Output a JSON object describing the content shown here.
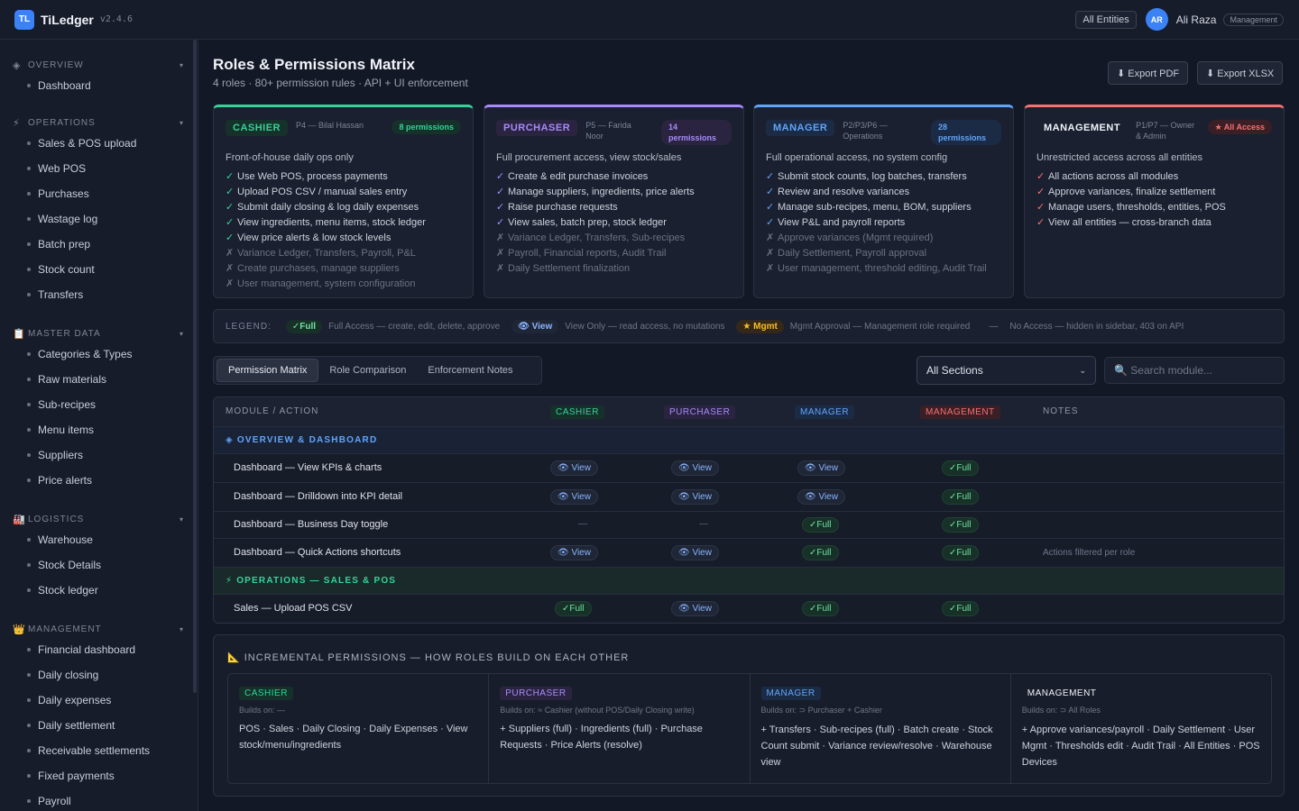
{
  "app": {
    "logo": "TL",
    "name": "TiLedger",
    "version": "v2.4.6"
  },
  "topbar": {
    "entity_button": "All Entities",
    "avatar": "AR",
    "user_name": "Ali Raza",
    "role": "Management"
  },
  "sidebar": {
    "sections": [
      {
        "icon": "◈",
        "icon_name": "overview-icon",
        "title": "OVERVIEW",
        "items": [
          "Dashboard"
        ]
      },
      {
        "icon": "⚡",
        "icon_name": "lightning-icon",
        "title": "OPERATIONS",
        "items": [
          "Sales & POS upload",
          "Web POS",
          "Purchases",
          "Wastage log",
          "Batch prep",
          "Stock count",
          "Transfers"
        ]
      },
      {
        "icon": "📋",
        "icon_name": "clipboard-icon",
        "title": "MASTER DATA",
        "items": [
          "Categories & Types",
          "Raw materials",
          "Sub-recipes",
          "Menu items",
          "Suppliers",
          "Price alerts"
        ]
      },
      {
        "icon": "🏭",
        "icon_name": "factory-icon",
        "title": "LOGISTICS",
        "items": [
          "Warehouse",
          "Stock Details",
          "Stock ledger"
        ]
      },
      {
        "icon": "👑",
        "icon_name": "crown-icon",
        "title": "MANAGEMENT",
        "items": [
          "Financial dashboard",
          "Daily closing",
          "Daily expenses",
          "Daily settlement",
          "Receivable settlements",
          "Fixed payments",
          "Payroll"
        ]
      }
    ]
  },
  "page": {
    "title": "Roles & Permissions Matrix",
    "subtitle": "4 roles · 80+ permission rules · API + UI enforcement",
    "export_pdf": "⬇ Export PDF",
    "export_xlsx": "⬇ Export XLSX"
  },
  "roles": [
    {
      "name": "CASHIER",
      "who": "P4 — Bilal Hassan",
      "count": "8 permissions",
      "color": "#34d399",
      "desc": "Front-of-house daily ops only",
      "allowed": [
        "Use Web POS, process payments",
        "Upload POS CSV / manual sales entry",
        "Submit daily closing & log daily expenses",
        "View ingredients, menu items, stock ledger",
        "View price alerts & low stock levels"
      ],
      "denied": [
        "Variance Ledger, Transfers, Payroll, P&L",
        "Create purchases, manage suppliers",
        "User management, system configuration"
      ]
    },
    {
      "name": "PURCHASER",
      "who": "P5 — Farida Noor",
      "count": "14 permissions",
      "color": "#a78bfa",
      "desc": "Full procurement access, view stock/sales",
      "allowed": [
        "Create & edit purchase invoices",
        "Manage suppliers, ingredients, price alerts",
        "Raise purchase requests",
        "View sales, batch prep, stock ledger"
      ],
      "denied": [
        "Variance Ledger, Transfers, Sub-recipes",
        "Payroll, Financial reports, Audit Trail",
        "Daily Settlement finalization"
      ]
    },
    {
      "name": "MANAGER",
      "who": "P2/P3/P6 — Operations",
      "count": "28 permissions",
      "color": "#60a5fa",
      "desc": "Full operational access, no system config",
      "allowed": [
        "Submit stock counts, log batches, transfers",
        "Review and resolve variances",
        "Manage sub-recipes, menu, BOM, suppliers",
        "View P&L and payroll reports"
      ],
      "denied": [
        "Approve variances (Mgmt required)",
        "Daily Settlement, Payroll approval",
        "User management, threshold editing, Audit Trail"
      ]
    },
    {
      "name": "MANAGEMENT",
      "who": "P1/P7 — Owner & Admin",
      "count": "★ All Access",
      "color": "#f87171",
      "desc": "Unrestricted access across all entities",
      "allowed": [
        "All actions across all modules",
        "Approve variances, finalize settlement",
        "Manage users, thresholds, entities, POS",
        "View all entities — cross-branch data"
      ],
      "denied": []
    }
  ],
  "legend": {
    "title": "LEGEND:",
    "full_pill": "✓Full",
    "full_text": "Full Access — create, edit, delete, approve",
    "view_pill": "👁 View",
    "view_text": "View Only — read access, no mutations",
    "mgmt_pill": "★ Mgmt",
    "mgmt_text": "Mgmt Approval — Management role required",
    "none_mark": "—",
    "none_text": "No Access — hidden in sidebar, 403 on API"
  },
  "tabs": [
    "Permission Matrix",
    "Role Comparison",
    "Enforcement Notes"
  ],
  "filter": {
    "selected": "All Sections",
    "search_placeholder": "🔍 Search module..."
  },
  "matrix": {
    "headers": {
      "module": "MODULE / ACTION",
      "cashier": "CASHIER",
      "purchaser": "PURCHASER",
      "manager": "MANAGER",
      "management": "MANAGEMENT",
      "notes": "NOTES"
    },
    "groups": [
      {
        "title": "◈  OVERVIEW & DASHBOARD",
        "color": "#60a5fa",
        "rows": [
          {
            "label": "Dashboard — View KPIs & charts",
            "cells": [
              "view",
              "view",
              "view",
              "full"
            ],
            "note": ""
          },
          {
            "label": "Dashboard — Drilldown into KPI detail",
            "cells": [
              "view",
              "view",
              "view",
              "full"
            ],
            "note": ""
          },
          {
            "label": "Dashboard — Business Day toggle",
            "cells": [
              "none",
              "none",
              "full",
              "full"
            ],
            "note": ""
          },
          {
            "label": "Dashboard — Quick Actions shortcuts",
            "cells": [
              "view",
              "view",
              "full",
              "full"
            ],
            "note": "Actions filtered per role"
          }
        ]
      },
      {
        "title": "⚡  OPERATIONS — SALES & POS",
        "color": "#34d399",
        "rows": [
          {
            "label": "Sales — Upload POS CSV",
            "cells": [
              "full",
              "view",
              "full",
              "full"
            ],
            "note": ""
          }
        ]
      }
    ],
    "cell_labels": {
      "view": "👁 View",
      "full": "✓Full",
      "none": "—"
    }
  },
  "incremental": {
    "title": "📐 INCREMENTAL PERMISSIONS — HOW ROLES BUILD ON EACH OTHER",
    "columns": [
      {
        "name": "CASHIER",
        "builds": "Builds on: —",
        "text": "POS · Sales · Daily Closing · Daily Expenses · View stock/menu/ingredients"
      },
      {
        "name": "PURCHASER",
        "builds": "Builds on: ≈ Cashier (without POS/Daily Closing write)",
        "text": "+ Suppliers (full) · Ingredients (full) · Purchase Requests · Price Alerts (resolve)"
      },
      {
        "name": "MANAGER",
        "builds": "Builds on: ⊃ Purchaser + Cashier",
        "text": "+ Transfers · Sub-recipes (full) · Batch create · Stock Count submit · Variance review/resolve · Warehouse view"
      },
      {
        "name": "MANAGEMENT",
        "builds": "Builds on: ⊃ All Roles",
        "text": "+ Approve variances/payroll · Daily Settlement · User Mgmt · Thresholds edit · Audit Trail · All Entities · POS Devices"
      }
    ]
  }
}
